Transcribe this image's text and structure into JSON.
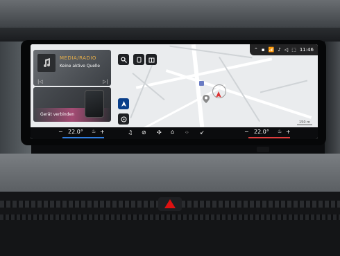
{
  "media": {
    "title": "MEDIA/RADIO",
    "subtitle": "Keine aktive Quelle",
    "prev_glyph": "|◁",
    "next_glyph": "▷|"
  },
  "device": {
    "label": "Gerät verbinden"
  },
  "status": {
    "time": "11:46"
  },
  "map": {
    "scale_label": "150 m"
  },
  "climate": {
    "left_temp": "22.0°",
    "right_temp": "22.0°",
    "left_minus": "−",
    "left_plus": "+",
    "right_minus": "−",
    "right_plus": "+",
    "auto_label": "A"
  },
  "colors": {
    "media_title": "#e8b04a",
    "left_bar": "#2f7de1",
    "right_bar": "#e03c3c",
    "hazard": "#dd1111"
  },
  "icons": {
    "search": "search-icon",
    "phone": "phone-icon",
    "poi": "building-icon",
    "navigation": "navigation-icon",
    "music": "music-note-icon",
    "home": "home-icon",
    "apps": "apps-grid-icon",
    "fan": "fan-icon",
    "seat_heat": "seat-heat-icon"
  }
}
